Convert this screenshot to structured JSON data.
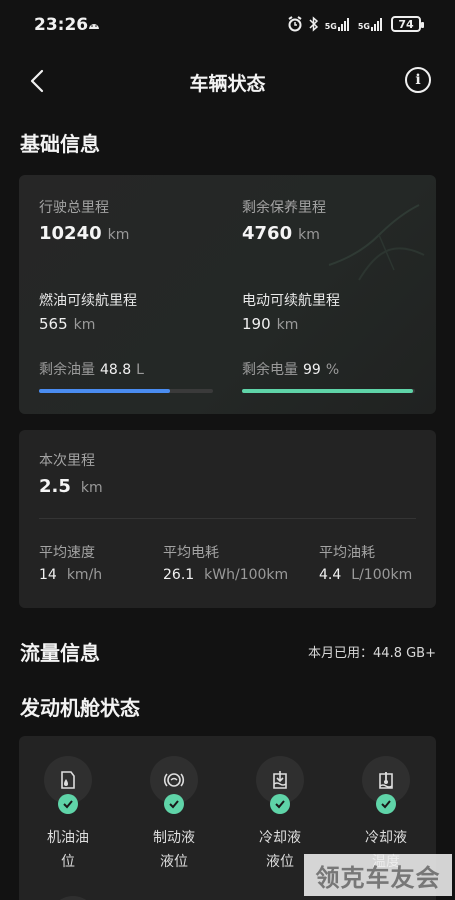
{
  "status_bar": {
    "time": "23:26",
    "network1": "5G",
    "network2": "5G",
    "battery": "74"
  },
  "nav": {
    "title": "车辆状态"
  },
  "basic_info": {
    "title": "基础信息",
    "total_mileage": {
      "label": "行驶总里程",
      "value": "10240",
      "unit": "km"
    },
    "maintenance_mileage": {
      "label": "剩余保养里程",
      "value": "4760",
      "unit": "km"
    },
    "fuel_range": {
      "label": "燃油可续航里程",
      "value": "565",
      "unit": "km"
    },
    "electric_range": {
      "label": "电动可续航里程",
      "value": "190",
      "unit": "km"
    },
    "fuel_remaining": {
      "label": "剩余油量",
      "value": "48.8",
      "unit": "L",
      "fraction": 0.75,
      "color": "#4a8cf0"
    },
    "battery_remaining": {
      "label": "剩余电量",
      "value": "99",
      "unit": "%",
      "fraction": 0.99,
      "color": "#5fd4a8"
    }
  },
  "trip": {
    "label": "本次里程",
    "value": "2.5",
    "unit": "km",
    "avg_speed": {
      "label": "平均速度",
      "value": "14",
      "unit": "km/h"
    },
    "avg_power": {
      "label": "平均电耗",
      "value": "26.1",
      "unit": "kWh/100km"
    },
    "avg_fuel": {
      "label": "平均油耗",
      "value": "4.4",
      "unit": "L/100km"
    }
  },
  "traffic": {
    "title": "流量信息",
    "used_label": "本月已用：44.8 GB+"
  },
  "engine": {
    "title": "发动机舱状态",
    "items": [
      {
        "label_l1": "机油油",
        "label_l2": "位",
        "icon": "oil-level-icon"
      },
      {
        "label_l1": "制动液",
        "label_l2": "液位",
        "icon": "brake-fluid-icon"
      },
      {
        "label_l1": "冷却液",
        "label_l2": "液位",
        "icon": "coolant-level-icon"
      },
      {
        "label_l1": "冷却液",
        "label_l2": "温度",
        "icon": "coolant-temp-icon"
      }
    ]
  },
  "watermark": "领克车友会"
}
